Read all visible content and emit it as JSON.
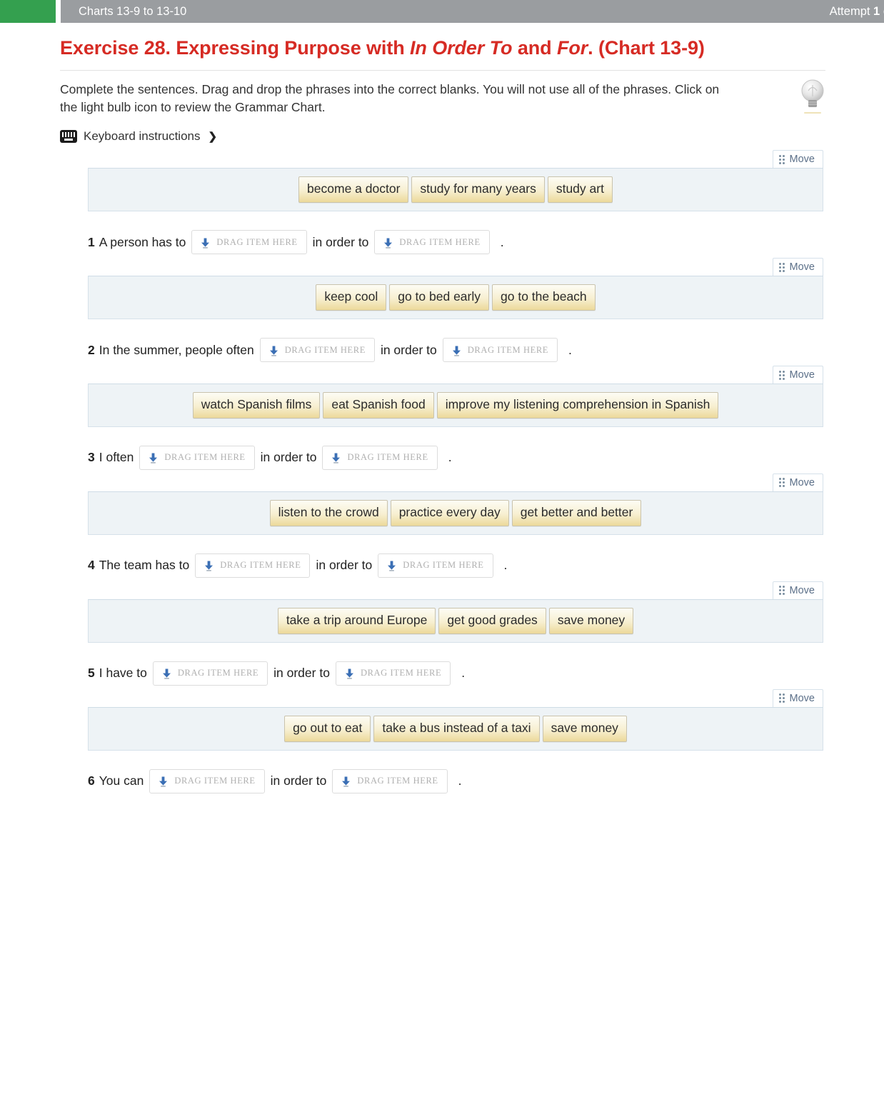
{
  "topbar": {
    "title": "Charts 13-9 to 13-10",
    "attempt_prefix": "Attempt ",
    "attempt_number": "1",
    "attempt_suffix": " o",
    "green_color": "#34a04f",
    "bar_color": "#9a9da0"
  },
  "exercise": {
    "title_part1": "Exercise 28. Expressing Purpose with ",
    "title_italic1": "In Order To",
    "title_part2": " and ",
    "title_italic2": "For",
    "title_part3": ". (Chart 13-9)",
    "title_color": "#d62b24",
    "instructions": "Complete the sentences. Drag and drop the phrases into the correct blanks. You will not use all of the phrases. Click on the light bulb icon to review the Grammar Chart.",
    "keyboard_label": "Keyboard instructions",
    "bulb_icon": "lightbulb-icon",
    "keyboard_icon": "keyboard-icon",
    "chevron": "⌄"
  },
  "common": {
    "move_label": "Move",
    "drop_placeholder": "Drag item here",
    "in_order_to": "in order to",
    "period": ".",
    "chip_gradient_top": "#fdfcf5",
    "chip_gradient_bottom": "#ecd99a",
    "bank_bg": "#eef3f6",
    "bank_border": "#d6e1ea"
  },
  "items": [
    {
      "number": "1",
      "chips": [
        "become a doctor",
        "study for many years",
        "study art"
      ],
      "lead_text": "A person has to",
      "mid_text": "in order to"
    },
    {
      "number": "2",
      "chips": [
        "keep cool",
        "go to bed early",
        "go to the beach"
      ],
      "lead_text": "In the summer, people often",
      "mid_text": "in order to"
    },
    {
      "number": "3",
      "chips": [
        "watch Spanish films",
        "eat Spanish food",
        "improve my listening comprehension in Spanish"
      ],
      "lead_text": "I often",
      "mid_text": "in order to"
    },
    {
      "number": "4",
      "chips": [
        "listen to the crowd",
        "practice every day",
        "get better and better"
      ],
      "lead_text": "The team has to",
      "mid_text": "in order to"
    },
    {
      "number": "5",
      "chips": [
        "take a trip around Europe",
        "get good grades",
        "save money"
      ],
      "lead_text": "I have to",
      "mid_text": "in order to"
    },
    {
      "number": "6",
      "chips": [
        "go out to eat",
        "take a bus instead of a taxi",
        "save money"
      ],
      "lead_text": "You can",
      "mid_text": "in order to"
    }
  ]
}
